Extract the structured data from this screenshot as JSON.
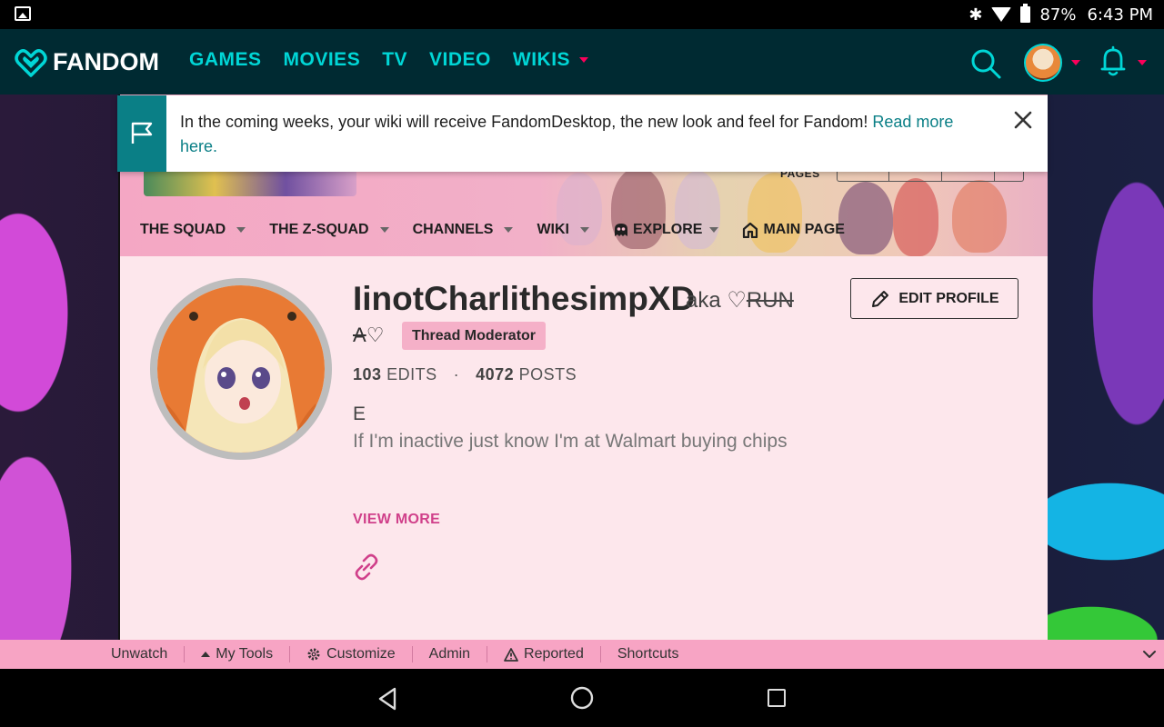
{
  "status_bar": {
    "battery": "87%",
    "time": "6:43 PM"
  },
  "global_nav": {
    "brand": "FANDOM",
    "links": [
      "GAMES",
      "MOVIES",
      "TV",
      "VIDEO",
      "WIKIS"
    ],
    "accent_color": "#00d6d6",
    "bg_color": "#002a32"
  },
  "banner": {
    "message": "In the coming weeks, your wiki will receive FandomDesktop, the new look and feel for Fandom! ",
    "link_text": "Read more",
    "link_text_2": "here."
  },
  "wiki_header": {
    "pages_label": "PAGES",
    "nav": [
      "THE SQUAD",
      "THE Z-SQUAD",
      "CHANNELS",
      "WIKI",
      "EXPLORE",
      "MAIN PAGE"
    ]
  },
  "profile": {
    "username": "IinotCharlithesimpXD",
    "aka_prefix": "aka ♡",
    "aka_struck_1": "RUN",
    "aka_struck_2": "A",
    "aka_suffix": "♡",
    "tag": "Thread Moderator",
    "edit_button": "EDIT PROFILE",
    "edits_count": "103",
    "edits_label": "EDITS",
    "separator": "·",
    "posts_count": "4072",
    "posts_label": "POSTS",
    "bio_line_1": "E",
    "bio_line_2": "If I'm inactive just know I'm at Walmart buying chips",
    "view_more": "VIEW MORE"
  },
  "toolbar": {
    "items": [
      "Unwatch",
      "My Tools",
      "Customize",
      "Admin",
      "Reported",
      "Shortcuts"
    ],
    "bg_color": "#f7a4c4"
  }
}
